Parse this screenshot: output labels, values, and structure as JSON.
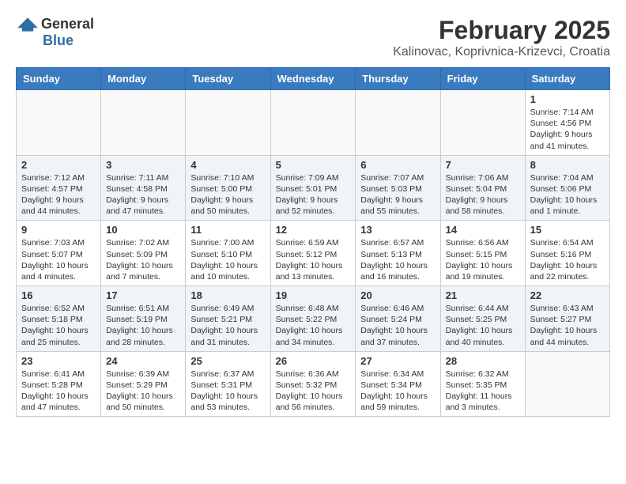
{
  "header": {
    "logo_general": "General",
    "logo_blue": "Blue",
    "month_title": "February 2025",
    "location": "Kalinovac, Koprivnica-Krizevci, Croatia"
  },
  "weekdays": [
    "Sunday",
    "Monday",
    "Tuesday",
    "Wednesday",
    "Thursday",
    "Friday",
    "Saturday"
  ],
  "weeks": [
    [
      {
        "day": "",
        "info": ""
      },
      {
        "day": "",
        "info": ""
      },
      {
        "day": "",
        "info": ""
      },
      {
        "day": "",
        "info": ""
      },
      {
        "day": "",
        "info": ""
      },
      {
        "day": "",
        "info": ""
      },
      {
        "day": "1",
        "info": "Sunrise: 7:14 AM\nSunset: 4:56 PM\nDaylight: 9 hours and 41 minutes."
      }
    ],
    [
      {
        "day": "2",
        "info": "Sunrise: 7:12 AM\nSunset: 4:57 PM\nDaylight: 9 hours and 44 minutes."
      },
      {
        "day": "3",
        "info": "Sunrise: 7:11 AM\nSunset: 4:58 PM\nDaylight: 9 hours and 47 minutes."
      },
      {
        "day": "4",
        "info": "Sunrise: 7:10 AM\nSunset: 5:00 PM\nDaylight: 9 hours and 50 minutes."
      },
      {
        "day": "5",
        "info": "Sunrise: 7:09 AM\nSunset: 5:01 PM\nDaylight: 9 hours and 52 minutes."
      },
      {
        "day": "6",
        "info": "Sunrise: 7:07 AM\nSunset: 5:03 PM\nDaylight: 9 hours and 55 minutes."
      },
      {
        "day": "7",
        "info": "Sunrise: 7:06 AM\nSunset: 5:04 PM\nDaylight: 9 hours and 58 minutes."
      },
      {
        "day": "8",
        "info": "Sunrise: 7:04 AM\nSunset: 5:06 PM\nDaylight: 10 hours and 1 minute."
      }
    ],
    [
      {
        "day": "9",
        "info": "Sunrise: 7:03 AM\nSunset: 5:07 PM\nDaylight: 10 hours and 4 minutes."
      },
      {
        "day": "10",
        "info": "Sunrise: 7:02 AM\nSunset: 5:09 PM\nDaylight: 10 hours and 7 minutes."
      },
      {
        "day": "11",
        "info": "Sunrise: 7:00 AM\nSunset: 5:10 PM\nDaylight: 10 hours and 10 minutes."
      },
      {
        "day": "12",
        "info": "Sunrise: 6:59 AM\nSunset: 5:12 PM\nDaylight: 10 hours and 13 minutes."
      },
      {
        "day": "13",
        "info": "Sunrise: 6:57 AM\nSunset: 5:13 PM\nDaylight: 10 hours and 16 minutes."
      },
      {
        "day": "14",
        "info": "Sunrise: 6:56 AM\nSunset: 5:15 PM\nDaylight: 10 hours and 19 minutes."
      },
      {
        "day": "15",
        "info": "Sunrise: 6:54 AM\nSunset: 5:16 PM\nDaylight: 10 hours and 22 minutes."
      }
    ],
    [
      {
        "day": "16",
        "info": "Sunrise: 6:52 AM\nSunset: 5:18 PM\nDaylight: 10 hours and 25 minutes."
      },
      {
        "day": "17",
        "info": "Sunrise: 6:51 AM\nSunset: 5:19 PM\nDaylight: 10 hours and 28 minutes."
      },
      {
        "day": "18",
        "info": "Sunrise: 6:49 AM\nSunset: 5:21 PM\nDaylight: 10 hours and 31 minutes."
      },
      {
        "day": "19",
        "info": "Sunrise: 6:48 AM\nSunset: 5:22 PM\nDaylight: 10 hours and 34 minutes."
      },
      {
        "day": "20",
        "info": "Sunrise: 6:46 AM\nSunset: 5:24 PM\nDaylight: 10 hours and 37 minutes."
      },
      {
        "day": "21",
        "info": "Sunrise: 6:44 AM\nSunset: 5:25 PM\nDaylight: 10 hours and 40 minutes."
      },
      {
        "day": "22",
        "info": "Sunrise: 6:43 AM\nSunset: 5:27 PM\nDaylight: 10 hours and 44 minutes."
      }
    ],
    [
      {
        "day": "23",
        "info": "Sunrise: 6:41 AM\nSunset: 5:28 PM\nDaylight: 10 hours and 47 minutes."
      },
      {
        "day": "24",
        "info": "Sunrise: 6:39 AM\nSunset: 5:29 PM\nDaylight: 10 hours and 50 minutes."
      },
      {
        "day": "25",
        "info": "Sunrise: 6:37 AM\nSunset: 5:31 PM\nDaylight: 10 hours and 53 minutes."
      },
      {
        "day": "26",
        "info": "Sunrise: 6:36 AM\nSunset: 5:32 PM\nDaylight: 10 hours and 56 minutes."
      },
      {
        "day": "27",
        "info": "Sunrise: 6:34 AM\nSunset: 5:34 PM\nDaylight: 10 hours and 59 minutes."
      },
      {
        "day": "28",
        "info": "Sunrise: 6:32 AM\nSunset: 5:35 PM\nDaylight: 11 hours and 3 minutes."
      },
      {
        "day": "",
        "info": ""
      }
    ]
  ]
}
